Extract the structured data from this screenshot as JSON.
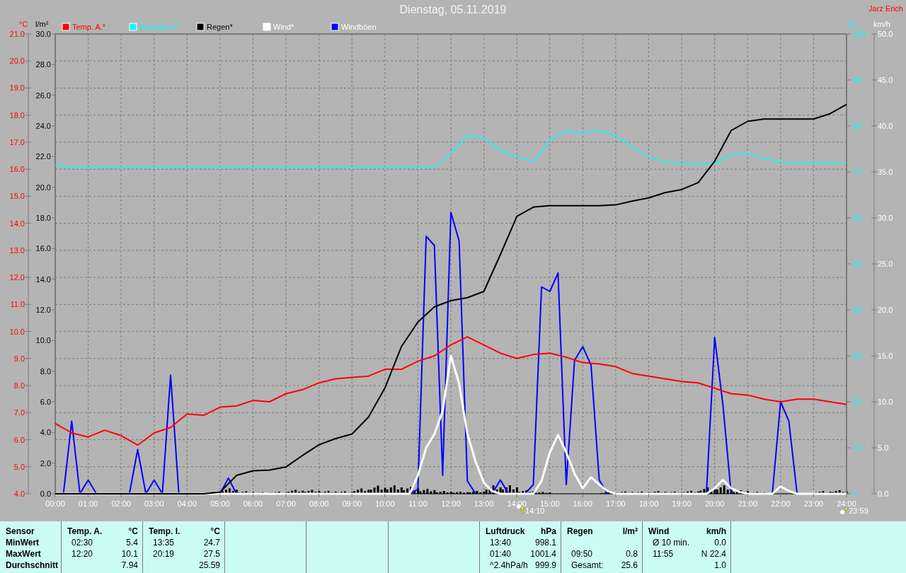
{
  "header": {
    "title": "Dienstag, 05.11.2019",
    "author": "Jarz Erich"
  },
  "chart": {
    "chart_data": {
      "type": "line",
      "ylabel": "°C",
      "xlim": [
        0,
        24
      ],
      "ylim": [
        4,
        21
      ],
      "y2lim": [
        0,
        100
      ],
      "y3lim": [
        0,
        30
      ],
      "grid": true,
      "legend": "top",
      "y2ticks": [
        {
          "value": 0,
          "label": "0"
        },
        {
          "value": 10,
          "label": "10"
        },
        {
          "value": 20,
          "label": "20"
        },
        {
          "value": 30,
          "label": "30"
        },
        {
          "value": 40,
          "label": "40"
        },
        {
          "value": 50,
          "label": "50"
        },
        {
          "value": 60,
          "label": "60"
        },
        {
          "value": 70,
          "label": "70"
        },
        {
          "value": 80,
          "label": "80"
        },
        {
          "value": 90,
          "label": "90"
        },
        {
          "value": 100,
          "label": "100"
        }
      ],
      "y3ticks": [
        {
          "value": 0,
          "label": "0.0"
        },
        {
          "value": 2,
          "label": "2.0"
        },
        {
          "value": 4,
          "label": "4.0"
        },
        {
          "value": 6,
          "label": "6.0"
        },
        {
          "value": 8,
          "label": "8.0"
        },
        {
          "value": 10,
          "label": "10.0"
        },
        {
          "value": 12,
          "label": "12.0"
        },
        {
          "value": 14,
          "label": "14.0"
        },
        {
          "value": 16,
          "label": "16.0"
        },
        {
          "value": 18,
          "label": "18.0"
        },
        {
          "value": 20,
          "label": "20.0"
        },
        {
          "value": 22,
          "label": "22.0"
        },
        {
          "value": 24,
          "label": "24.0"
        },
        {
          "value": 26,
          "label": "26.0"
        },
        {
          "value": 28,
          "label": "28.0"
        },
        {
          "value": 30,
          "label": "30.0"
        }
      ],
      "x": [
        0,
        0.5,
        1,
        1.5,
        2,
        2.5,
        3,
        3.5,
        4,
        4.5,
        5,
        5.5,
        6,
        6.5,
        7,
        7.5,
        8,
        8.5,
        9,
        9.5,
        10,
        10.5,
        11,
        11.5,
        12,
        12.5,
        13,
        13.5,
        14,
        14.5,
        15,
        15.5,
        16,
        16.5,
        17,
        17.5,
        18,
        18.5,
        19,
        19.5,
        20,
        20.5,
        21,
        21.5,
        22,
        22.5,
        23,
        23.5,
        24
      ],
      "xticks": [
        {
          "value": 0,
          "label": "00:00"
        },
        {
          "value": 1,
          "label": "01:00"
        },
        {
          "value": 2,
          "label": "02:00"
        },
        {
          "value": 3,
          "label": "03:00"
        },
        {
          "value": 4,
          "label": "04:00"
        },
        {
          "value": 5,
          "label": "05:00"
        },
        {
          "value": 6,
          "label": "06:00"
        },
        {
          "value": 7,
          "label": "07:00"
        },
        {
          "value": 8,
          "label": "08:00"
        },
        {
          "value": 9,
          "label": "09:00"
        },
        {
          "value": 10,
          "label": "10:00"
        },
        {
          "value": 11,
          "label": "11:00"
        },
        {
          "value": 12,
          "label": "12:00"
        },
        {
          "value": 13,
          "label": "13:00"
        },
        {
          "value": 14,
          "label": "14:00"
        },
        {
          "value": 15,
          "label": "15:00"
        },
        {
          "value": 16,
          "label": "16:00"
        },
        {
          "value": 17,
          "label": "17:00"
        },
        {
          "value": 18,
          "label": "18:00"
        },
        {
          "value": 19,
          "label": "19:00"
        },
        {
          "value": 20,
          "label": "20:00"
        },
        {
          "value": 21,
          "label": "21:00"
        },
        {
          "value": 22,
          "label": "22:00"
        },
        {
          "value": 23,
          "label": "23:00"
        },
        {
          "value": 24,
          "label": "24:00"
        }
      ],
      "yticks": [
        {
          "value": 4,
          "label": "4.0"
        },
        {
          "value": 5,
          "label": "5.0"
        },
        {
          "value": 6,
          "label": "6.0"
        },
        {
          "value": 7,
          "label": "7.0"
        },
        {
          "value": 8,
          "label": "8.0"
        },
        {
          "value": 9,
          "label": "9.0"
        },
        {
          "value": 10,
          "label": "10.0"
        },
        {
          "value": 11,
          "label": "11.0"
        },
        {
          "value": 12,
          "label": "12.0"
        },
        {
          "value": 13,
          "label": "13.0"
        },
        {
          "value": 14,
          "label": "14.0"
        },
        {
          "value": 15,
          "label": "15.0"
        },
        {
          "value": 16,
          "label": "16.0"
        },
        {
          "value": 17,
          "label": "17.0"
        },
        {
          "value": 18,
          "label": "18.0"
        },
        {
          "value": 19,
          "label": "19.0"
        },
        {
          "value": 20,
          "label": "20.0"
        },
        {
          "value": 21,
          "label": "21.0"
        }
      ],
      "series": [
        {
          "name": "Temp. A.*",
          "color": "#ff0000",
          "values": [
            6.6,
            6.25,
            6.1,
            6.35,
            6.15,
            5.8,
            6.25,
            6.45,
            6.95,
            6.9,
            7.2,
            7.25,
            7.45,
            7.4,
            7.7,
            7.85,
            8.1,
            8.25,
            8.3,
            8.35,
            8.6,
            8.6,
            8.9,
            9.1,
            9.5,
            9.8,
            9.5,
            9.2,
            9.0,
            9.15,
            9.2,
            9.05,
            8.85,
            8.8,
            8.7,
            8.45,
            8.35,
            8.25,
            8.15,
            8.1,
            7.9,
            7.7,
            7.65,
            7.5,
            7.4,
            7.5,
            7.5,
            7.4,
            7.3
          ]
        },
        {
          "name": "Feuchte A.*",
          "color": "#00ffff",
          "axis": "y2",
          "values": [
            71.5,
            71,
            71,
            71,
            71,
            71,
            71,
            71,
            71,
            71,
            71,
            71,
            71,
            71,
            71,
            71,
            71,
            71,
            71,
            71,
            71,
            71,
            71,
            71,
            74,
            78,
            77.4,
            74.8,
            73.2,
            72.3,
            77,
            78.8,
            78.5,
            79,
            77.8,
            75.4,
            73.2,
            72.2,
            71.8,
            71.7,
            71.8,
            73.8,
            74,
            72.9,
            72.2,
            72,
            72,
            72,
            72
          ]
        },
        {
          "name": "Regen*",
          "color": "#000000",
          "axis": "y3",
          "values": [
            0,
            0,
            0,
            0,
            0,
            0,
            0,
            0,
            0,
            0,
            0.1,
            1.2,
            1.5,
            1.55,
            1.75,
            2.5,
            3.2,
            3.6,
            3.9,
            5.0,
            6.9,
            9.6,
            11.2,
            12.2,
            12.6,
            12.8,
            13.2,
            15.6,
            18.1,
            18.7,
            18.8,
            18.8,
            18.8,
            18.8,
            18.85,
            19.1,
            19.3,
            19.65,
            19.85,
            20.3,
            21.7,
            23.7,
            24.3,
            24.45,
            24.45,
            24.45,
            24.45,
            24.8,
            25.4
          ]
        }
      ]
    },
    "axes": {
      "rain": {
        "unit": "l/m²"
      },
      "humidity": {
        "unit": "%"
      }
    },
    "markers": [
      {
        "kind": "up",
        "time": "14:10"
      },
      {
        "kind": "down",
        "time": "23:59"
      }
    ]
  },
  "wind_chart": {
    "chart_data": {
      "type": "line",
      "ylabel": "km/h",
      "xlim": [
        0,
        24
      ],
      "ylim": [
        0,
        50
      ],
      "x": [
        0,
        0.25,
        0.5,
        0.75,
        1,
        1.25,
        1.5,
        1.75,
        2,
        2.25,
        2.5,
        2.75,
        3,
        3.25,
        3.5,
        3.75,
        4,
        4.25,
        4.5,
        4.75,
        5,
        5.25,
        5.5,
        5.75,
        6,
        6.25,
        6.5,
        6.75,
        7,
        7.25,
        7.5,
        7.75,
        8,
        8.25,
        8.5,
        8.75,
        9,
        9.25,
        9.5,
        9.75,
        10,
        10.25,
        10.5,
        10.75,
        11,
        11.25,
        11.5,
        11.75,
        12,
        12.25,
        12.5,
        12.75,
        13,
        13.25,
        13.5,
        13.75,
        14,
        14.25,
        14.5,
        14.75,
        15,
        15.25,
        15.5,
        15.75,
        16,
        16.25,
        16.5,
        16.75,
        17,
        17.25,
        17.5,
        17.75,
        18,
        18.25,
        18.5,
        18.75,
        19,
        19.25,
        19.5,
        19.75,
        20,
        20.25,
        20.5,
        20.75,
        21,
        21.25,
        21.5,
        21.75,
        22,
        22.25,
        22.5,
        22.75,
        23,
        23.25,
        23.5,
        23.75,
        24
      ],
      "yticks": [
        {
          "value": 0,
          "label": "0.0"
        },
        {
          "value": 5,
          "label": "5.0"
        },
        {
          "value": 10,
          "label": "10.0"
        },
        {
          "value": 15,
          "label": "15.0"
        },
        {
          "value": 20,
          "label": "20.0"
        },
        {
          "value": 25,
          "label": "25.0"
        },
        {
          "value": 30,
          "label": "30.0"
        },
        {
          "value": 35,
          "label": "35.0"
        },
        {
          "value": 40,
          "label": "40.0"
        },
        {
          "value": 45,
          "label": "45.0"
        },
        {
          "value": 50,
          "label": "50.0"
        }
      ],
      "series": [
        {
          "name": "Wind*",
          "color": "#ffffff",
          "values": [
            0,
            0,
            0,
            0,
            0,
            0,
            0,
            0,
            0,
            0,
            0,
            0,
            0,
            0,
            0,
            0,
            0,
            0,
            0,
            0,
            0,
            0,
            0,
            0,
            0,
            0,
            0,
            0,
            0,
            0,
            0,
            0,
            0,
            0,
            0,
            0,
            0,
            0,
            0,
            0,
            0,
            0,
            0,
            0,
            2,
            5,
            6.5,
            9,
            15,
            12,
            6.5,
            3.5,
            1.2,
            0.3,
            0,
            0,
            0,
            0,
            0,
            1.4,
            4.5,
            6.4,
            4.5,
            2.2,
            0.6,
            1.8,
            1,
            0.3,
            0,
            0,
            0,
            0,
            0,
            0,
            0,
            0,
            0,
            0,
            0,
            0,
            0.6,
            1.5,
            0.6,
            0.2,
            0,
            0,
            0,
            0,
            0.8,
            0.3,
            0,
            0,
            0,
            0,
            0,
            0,
            0
          ]
        },
        {
          "name": "Windböen",
          "color": "#0000ff",
          "values": [
            null,
            0,
            7.9,
            0,
            1.5,
            0,
            null,
            null,
            null,
            0,
            4.8,
            0,
            1.5,
            0,
            12.9,
            0,
            null,
            null,
            null,
            null,
            0,
            1.7,
            0,
            null,
            null,
            null,
            null,
            null,
            null,
            null,
            null,
            null,
            null,
            null,
            null,
            null,
            null,
            null,
            null,
            null,
            null,
            null,
            null,
            0,
            0.5,
            28,
            27,
            2,
            30.6,
            27.5,
            1.4,
            0,
            null,
            0,
            1.5,
            0,
            null,
            0,
            1,
            22.5,
            22,
            24,
            1,
            14.5,
            16,
            14,
            1.5,
            0,
            null,
            null,
            null,
            null,
            null,
            null,
            null,
            null,
            null,
            null,
            null,
            0,
            17,
            9.7,
            0,
            null,
            null,
            null,
            null,
            0,
            10,
            7.9,
            0,
            null,
            null,
            null,
            null,
            null,
            null
          ]
        }
      ]
    }
  },
  "stats": {
    "row_labels": [
      "Sensor",
      "MinWert",
      "MaxWert",
      "Durchschnitt"
    ],
    "groups": [
      {
        "title": "Temp. A.",
        "unit": "°C",
        "rows": [
          {
            "time": "02:30",
            "value": "5.4"
          },
          {
            "time": "12:20",
            "value": "10.1"
          },
          {
            "value": "7.94"
          }
        ]
      },
      {
        "title": "Temp. I.",
        "unit": "°C",
        "rows": [
          {
            "time": "13:35",
            "value": "24.7"
          },
          {
            "time": "20:19",
            "value": "27.5"
          },
          {
            "value": "25.59"
          }
        ]
      },
      {
        "title": "Luftdruck",
        "unit": "hPa",
        "rows": [
          {
            "time": "13:40",
            "value": "998.1"
          },
          {
            "time": "01:40",
            "value": "1001.4"
          },
          {
            "time": "^2.4hPa/h",
            "value": "999.9"
          }
        ]
      },
      {
        "title": "Regen",
        "unit": "l/m²",
        "rows": [
          null,
          {
            "time": "09:50",
            "value": "0.8"
          },
          {
            "time": "Gesamt:",
            "value": "25.6"
          }
        ]
      },
      {
        "title": "Wind",
        "unit": "km/h",
        "rows": [
          {
            "time": "Ø 10 min.",
            "value": "0.0"
          },
          {
            "time": "11:55",
            "value": "N 22.4"
          },
          {
            "value": "1.0"
          }
        ]
      }
    ]
  }
}
